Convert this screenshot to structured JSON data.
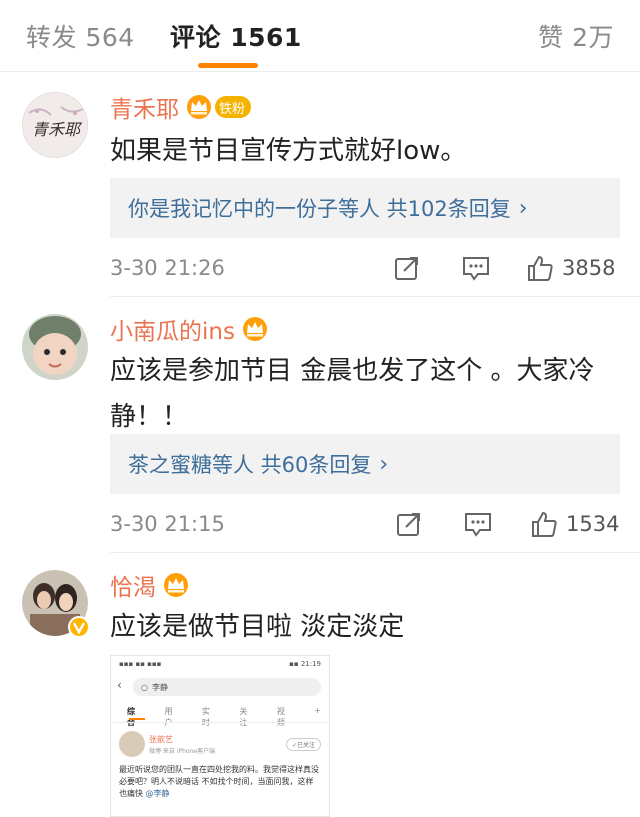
{
  "tabs": {
    "repost": "转发 564",
    "comments": "评论 1561",
    "likes": "赞 2万"
  },
  "colors": {
    "accent": "#ff8200",
    "username": "#eb7350",
    "link": "#3e6e9a",
    "fan_badge": "#f5b300"
  },
  "comments": [
    {
      "avatar_text": "青禾耶",
      "username": "青禾耶",
      "badges": [
        "vip-crown-icon"
      ],
      "fan_badge": "铁粉",
      "text": "如果是节目宣传方式就好low。",
      "reply_summary": "你是我记忆中的一份子等人  共102条回复",
      "time": "3-30 21:26",
      "likes": "3858"
    },
    {
      "username": "小南瓜的ins",
      "badges": [
        "vip-crown-icon"
      ],
      "text": "应该是参加节目  金晨也发了这个 。大家冷静！！",
      "reply_summary": "茶之蜜糖等人  共60条回复",
      "time": "3-30 21:15",
      "likes": "1534"
    },
    {
      "username": "恰渴",
      "badges": [
        "vip-crown-icon",
        "verified-icon"
      ],
      "text": "应该是做节目啦 淡定淡定",
      "embedded_screenshot": {
        "status_left": "▪▪▪ ▪▪ ▪▪▪",
        "status_right": "▪▪ 21:19",
        "search_query": "李静",
        "tabs": [
          "综合",
          "用户",
          "实时",
          "关注",
          "视频"
        ],
        "plus": "+",
        "author": "张歆艺",
        "source": "微博  来自 iPhone客户端",
        "follow_label": "✓已关注",
        "body": "最近听说您的团队一直在四处挖我的料。我觉得这样真没必要吧？明人不说暗话 不如找个时间，当面问我，这样也痛快",
        "mention": "@李静"
      }
    }
  ]
}
